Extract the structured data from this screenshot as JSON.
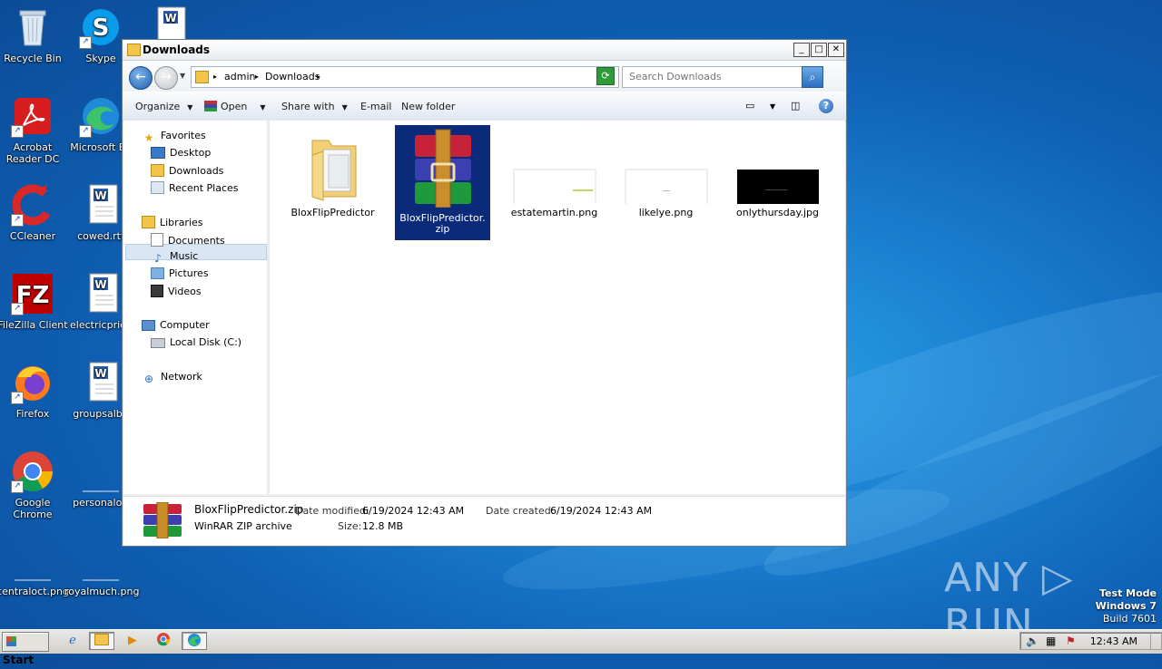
{
  "desktop": {
    "icons": [
      {
        "label": "Recycle Bin",
        "icon": "recycle-bin-icon"
      },
      {
        "label": "Skype",
        "icon": "skype-icon"
      },
      {
        "label": "Acrobat Reader DC",
        "icon": "acrobat-icon"
      },
      {
        "label": "Microsoft Ed",
        "icon": "edge-icon"
      },
      {
        "label": "CCleaner",
        "icon": "ccleaner-icon"
      },
      {
        "label": "cowed.rtf",
        "icon": "word-doc-icon"
      },
      {
        "label": "FileZilla Client",
        "icon": "filezilla-icon"
      },
      {
        "label": "electricprice",
        "icon": "word-doc-icon"
      },
      {
        "label": "Firefox",
        "icon": "firefox-icon"
      },
      {
        "label": "groupsalbu",
        "icon": "word-doc-icon"
      },
      {
        "label": "Google Chrome",
        "icon": "chrome-icon"
      },
      {
        "label": "personaloff",
        "icon": "blank-file-icon"
      },
      {
        "label": "centraloct.png",
        "icon": "blank-file-icon"
      },
      {
        "label": "royalmuch.png",
        "icon": "blank-file-icon"
      }
    ]
  },
  "window": {
    "title": "Downloads",
    "minimize": "_",
    "maximize": "□",
    "close": "✕",
    "address": {
      "crumbs": [
        "admin",
        "Downloads"
      ],
      "search_placeholder": "Search Downloads"
    },
    "toolbar": {
      "organize": "Organize",
      "open": "Open",
      "share_with": "Share with",
      "email": "E-mail",
      "new_folder": "New folder",
      "help": "?"
    },
    "nav": {
      "favorites": "Favorites",
      "desktop": "Desktop",
      "downloads": "Downloads",
      "recent_places": "Recent Places",
      "libraries": "Libraries",
      "documents": "Documents",
      "music": "Music",
      "pictures": "Pictures",
      "videos": "Videos",
      "computer": "Computer",
      "local_disk": "Local Disk (C:)",
      "network": "Network"
    },
    "files": [
      {
        "name": "BloxFlipPredictor",
        "type": "folder"
      },
      {
        "name": "BloxFlipPredictor.zip",
        "type": "winrar-zip",
        "selected": true
      },
      {
        "name": "estatemartin.png",
        "type": "image-light"
      },
      {
        "name": "likelye.png",
        "type": "image-light"
      },
      {
        "name": "onlythursday.jpg",
        "type": "image-dark"
      }
    ],
    "details": {
      "name": "BloxFlipPredictor.zip",
      "type": "WinRAR ZIP archive",
      "date_modified_label": "Date modified:",
      "date_modified": "6/19/2024 12:43 AM",
      "date_created_label": "Date created:",
      "date_created": "6/19/2024 12:43 AM",
      "size_label": "Size:",
      "size": "12.8 MB"
    }
  },
  "watermark": {
    "brand": "ANY ▷ RUN",
    "mode": "Test Mode",
    "os": "Windows 7",
    "build": "Build 7601"
  },
  "taskbar": {
    "start": "Start",
    "clock": "12:43 AM"
  }
}
